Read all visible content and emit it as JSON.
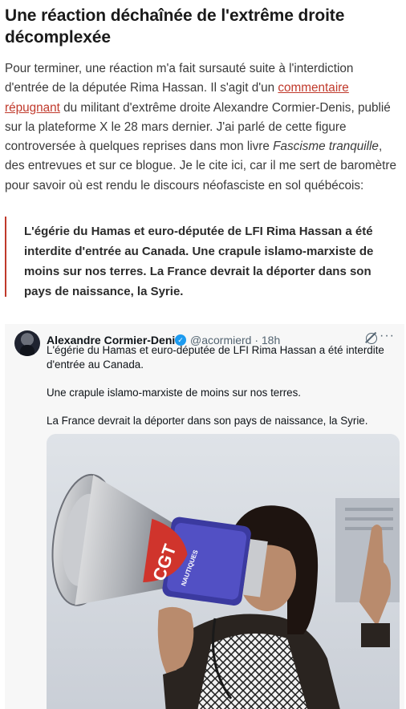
{
  "article": {
    "heading": "Une réaction déchaînée de l'extrême droite décomplexée",
    "para_1": "Pour terminer, une réaction m'a fait sursauté suite à l'interdiction d'entrée de la députée Rima Hassan. Il s'agit d'un ",
    "link_text": "commentaire répugnant",
    "para_2": " du militant d'extrême droite Alexandre Cormier-Denis, publié sur la plateforme X le 28 mars dernier. J'ai parlé de cette figure controversée à quelques reprises dans mon livre ",
    "book_title": "Fascisme tranquille",
    "para_3": ", des entrevues et sur ce blogue. Je le cite ici, car il me sert de baromètre pour savoir où est rendu le discours néofasciste en sol québécois:",
    "quote": "L'égérie du Hamas et euro-députée de LFI Rima Hassan a été interdite d'entrée au Canada. Une crapule islamo-marxiste de moins sur nos terres. La France devrait la déporter dans son pays de naissance, la Syrie.",
    "accent_color": "#c0392b"
  },
  "tweet": {
    "author": "Alexandre Cormier-Denis",
    "handle_time": "@acormierd · 18h",
    "lines": [
      "L'égérie du Hamas et euro-députée de LFI Rima Hassan a été interdite d'entrée au Canada.",
      "Une crapule islamo-marxiste de moins sur nos terres.",
      "La France devrait la déporter dans son pays de naissance, la Syrie."
    ],
    "megaphone_text": "CGT",
    "megaphone_subtext": "NAUTIQUES",
    "icons": [
      "avatar",
      "verified-badge-icon",
      "grok-icon",
      "more-icon"
    ],
    "verified_color": "#1d9bf0"
  }
}
